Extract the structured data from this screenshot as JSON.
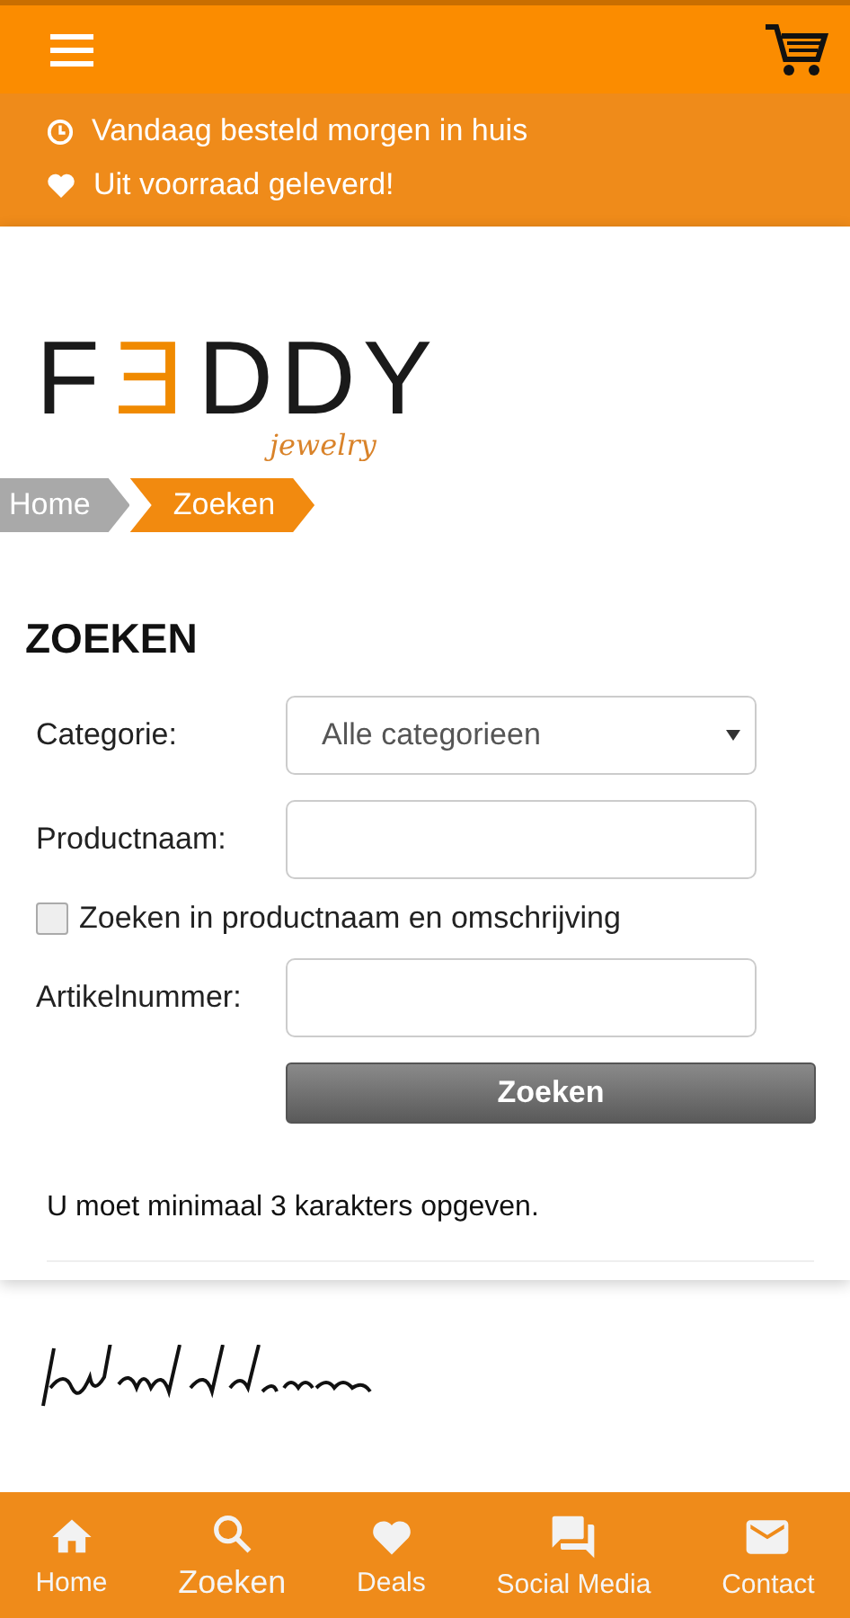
{
  "header": {
    "usps": [
      {
        "kind": "clock",
        "text": "Vandaag besteld morgen in huis"
      },
      {
        "kind": "heart",
        "text": "Uit voorraad geleverd!"
      }
    ]
  },
  "logo": {
    "parts": [
      {
        "text": "F",
        "accent": false
      },
      {
        "text": "Ǝ",
        "accent": true
      },
      {
        "text": "DDY",
        "accent": false
      }
    ],
    "tagline": "jewelry"
  },
  "breadcrumb": [
    {
      "label": "Home",
      "selected": false
    },
    {
      "label": "Zoeken",
      "selected": true
    }
  ],
  "form": {
    "title": "ZOEKEN",
    "fields": [
      {
        "kind": "select",
        "label": "Categorie:",
        "value": "Alle categorieen"
      },
      {
        "kind": "text",
        "label": "Productnaam:"
      },
      {
        "kind": "checkbox",
        "label": "Zoeken in productnaam en omschrijving",
        "checked": false
      },
      {
        "kind": "text",
        "label": "Artikelnummer:"
      }
    ],
    "submit": "Zoeken",
    "message": "U moet minimaal 3 karakters opgeven."
  },
  "bottom_nav": [
    {
      "kind": "home",
      "label": "Home",
      "selected": false
    },
    {
      "kind": "search",
      "label": "Zoeken",
      "selected": true
    },
    {
      "kind": "heart",
      "label": "Deals",
      "selected": false
    },
    {
      "kind": "chat",
      "label": "Social Media",
      "selected": false
    },
    {
      "kind": "mail",
      "label": "Contact",
      "selected": false
    }
  ]
}
